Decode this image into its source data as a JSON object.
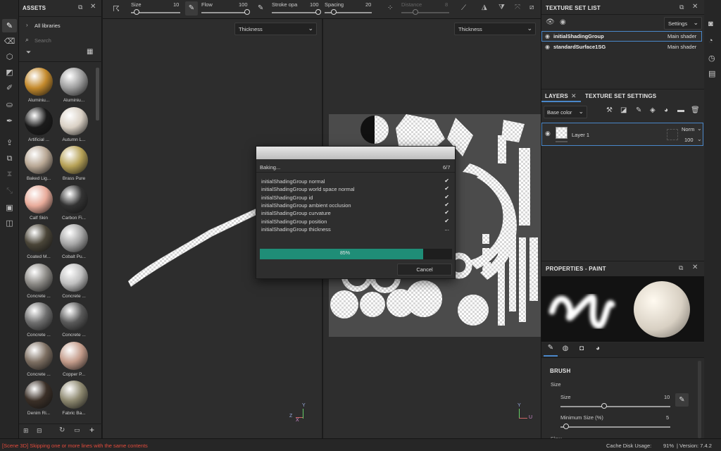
{
  "status": {
    "message": "[Scene 3D] Skipping one or more lines with the same contents",
    "cache_label": "Cache Disk Usage:",
    "cache_value": "91%",
    "version": "| Version: 7.4.2"
  },
  "toolbar": {
    "size_label": "Size",
    "size_value": "10",
    "flow_label": "Flow",
    "flow_value": "100",
    "stroke_label": "Stroke opa",
    "stroke_value": "100",
    "spacing_label": "Spacing",
    "spacing_value": "20",
    "distance_label": "Distance",
    "distance_value": "8",
    "size_level": 0.12,
    "flow_level": 1.0,
    "stroke_level": 1.0,
    "spacing_level": 0.2,
    "distance_level": 0.3
  },
  "assets": {
    "title": "ASSETS",
    "library": "All libraries",
    "search_placeholder": "Search",
    "items": [
      {
        "label": "Aluminiu...",
        "color": "#c48a2c"
      },
      {
        "label": "Aluminiu...",
        "color": "#9e9e9e"
      },
      {
        "label": "Artificial ...",
        "color": "#1b1b1b"
      },
      {
        "label": "Autumn L...",
        "color": "#d9d0c4"
      },
      {
        "label": "Baked Lig...",
        "color": "#b8a794"
      },
      {
        "label": "Brass Pure",
        "color": "#b7a257"
      },
      {
        "label": "Calf Skin",
        "color": "#e8ab9a"
      },
      {
        "label": "Carbon Fi...",
        "color": "#333333"
      },
      {
        "label": "Coated M...",
        "color": "#4a4538"
      },
      {
        "label": "Cobalt Pu...",
        "color": "#a5a5a5"
      },
      {
        "label": "Concrete ...",
        "color": "#8c8a86"
      },
      {
        "label": "Concrete ...",
        "color": "#bfbfbf"
      },
      {
        "label": "Concrete ...",
        "color": "#6f6f6f"
      },
      {
        "label": "Concrete ...",
        "color": "#5a5a5a"
      },
      {
        "label": "Concrete ...",
        "color": "#7d6f62"
      },
      {
        "label": "Copper P...",
        "color": "#c39b8a"
      },
      {
        "label": "Denim Ri...",
        "color": "#3a2f27"
      },
      {
        "label": "Fabric Ba...",
        "color": "#8d886f"
      }
    ]
  },
  "viewport": {
    "left_channel": "Thickness",
    "right_channel": "Thickness"
  },
  "dialog": {
    "status": "Baking...",
    "step": "6/7",
    "items": [
      {
        "label": "initialShadingGroup normal",
        "state": "✔"
      },
      {
        "label": "initialShadingGroup world space normal",
        "state": "✔"
      },
      {
        "label": "initialShadingGroup id",
        "state": "✔"
      },
      {
        "label": "initialShadingGroup ambient occlusion",
        "state": "✔"
      },
      {
        "label": "initialShadingGroup curvature",
        "state": "✔"
      },
      {
        "label": "initialShadingGroup position",
        "state": "✔"
      },
      {
        "label": "initialShadingGroup thickness",
        "state": "..."
      }
    ],
    "progress_text": "85%",
    "progress": 0.85,
    "cancel_label": "Cancel",
    "accent": "#1f8d77"
  },
  "texture_sets": {
    "title": "TEXTURE SET LIST",
    "settings_label": "Settings",
    "rows": [
      {
        "name": "initialShadingGroup",
        "shader": "Main shader"
      },
      {
        "name": "standardSurface1SG",
        "shader": "Main shader"
      }
    ]
  },
  "layers": {
    "tab_layers": "LAYERS",
    "tab_settings": "TEXTURE SET SETTINGS",
    "channel": "Base color",
    "layer_name": "Layer 1",
    "blend": "Norm",
    "opacity": "100"
  },
  "properties": {
    "title": "PROPERTIES - PAINT",
    "brush_section": "BRUSH",
    "size_group": "Size",
    "size_label": "Size",
    "size_value": "10",
    "min_size_label": "Minimum Size (%)",
    "min_size_value": "5",
    "flow_label": "Flow",
    "size_level": 0.4,
    "min_size_level": 0.05
  }
}
